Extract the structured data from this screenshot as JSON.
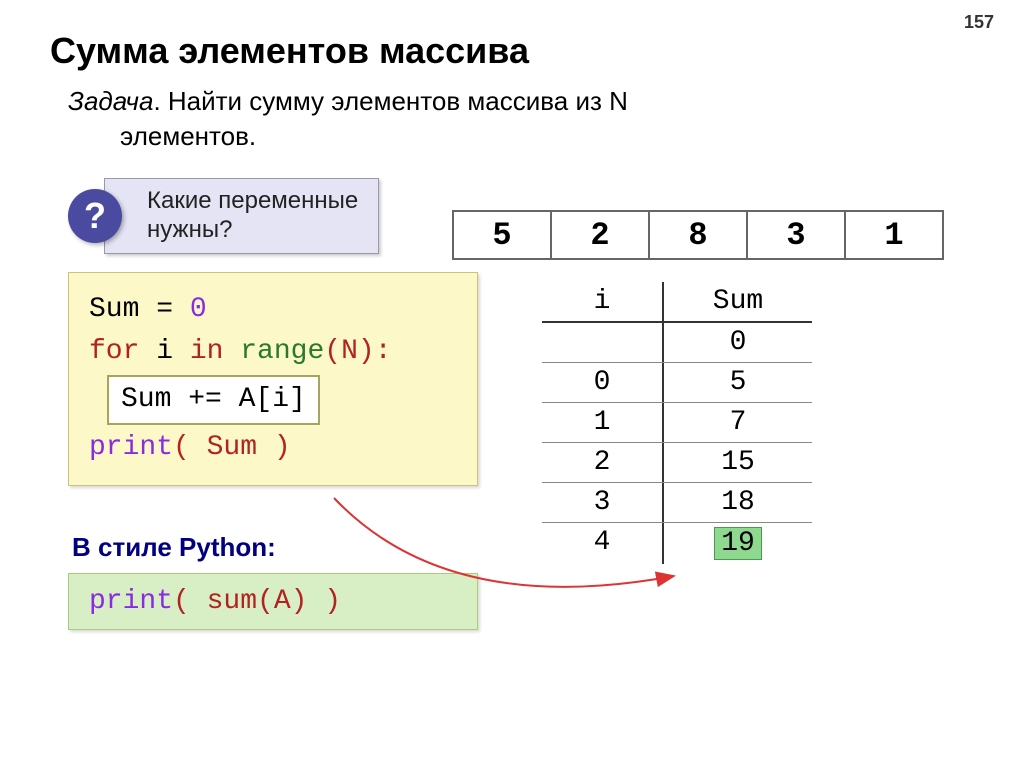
{
  "page_number": "157",
  "title": "Сумма элементов массива",
  "task_prefix": "Задача",
  "task_text_line1": ". Найти сумму элементов массива из N",
  "task_text_line2": "элементов.",
  "question_mark": "?",
  "question_line1": "Какие переменные",
  "question_line2": "нужны?",
  "array": [
    "5",
    "2",
    "8",
    "3",
    "1"
  ],
  "code": {
    "l1_a": "Sum = ",
    "l1_b": "0",
    "l2_a": "for",
    "l2_b": " i ",
    "l2_c": "in",
    "l2_d": " range",
    "l2_e": "(N):",
    "l3": "Sum += A[i]",
    "l4_a": "print",
    "l4_b": "( Sum )"
  },
  "trace": {
    "header_i": "i",
    "header_sum": "Sum",
    "rows": [
      {
        "i": "",
        "sum": "0"
      },
      {
        "i": "0",
        "sum": "5"
      },
      {
        "i": "1",
        "sum": "7"
      },
      {
        "i": "2",
        "sum": "15"
      },
      {
        "i": "3",
        "sum": "18"
      },
      {
        "i": "4",
        "sum": "19"
      }
    ]
  },
  "style_label": "В стиле Python:",
  "code_green_a": "print",
  "code_green_b": "( sum(A) )"
}
